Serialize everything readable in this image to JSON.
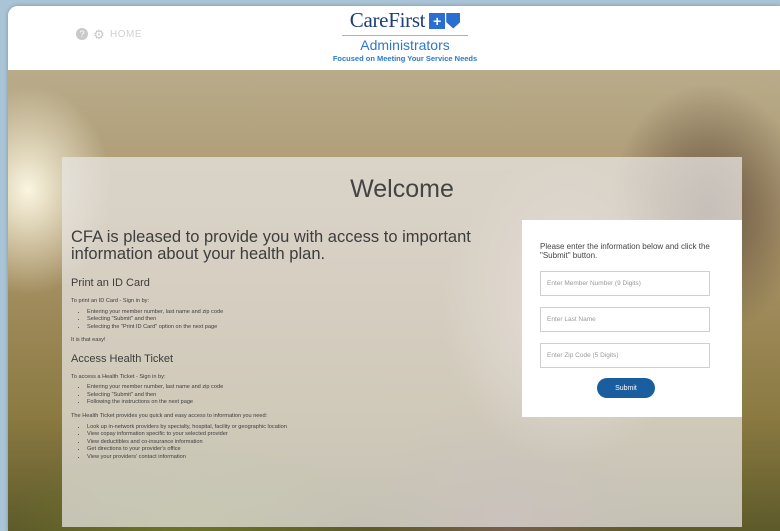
{
  "header": {
    "nav": {
      "help_icon": "?",
      "settings_icon": "⚙",
      "home_label": "HOME"
    },
    "brand": {
      "name": "CareFirst",
      "subtitle": "Administrators",
      "tagline": "Focused on Meeting Your Service Needs"
    }
  },
  "main": {
    "title": "Welcome",
    "intro": "CFA is pleased to provide you with access to important information about your health plan.",
    "print_id": {
      "heading": "Print an ID Card",
      "lead": "To print an ID Card - Sign in by:",
      "steps": [
        "Entering your member number, last name and zip code",
        "Selecting \"Submit\" and then",
        "Selecting the \"Print ID Card\" option on the next page"
      ],
      "note": "It is that easy!"
    },
    "health_ticket": {
      "heading": "Access Health Ticket",
      "lead": "To access a Health Ticket - Sign in by:",
      "steps": [
        "Entering your member number, last name and zip code",
        "Selecting \"Submit\" and then",
        "Following the instructions on the next page"
      ],
      "description": "The Health Ticket provides you quick and easy access to information you need:",
      "features": [
        "Look up in-network providers by specialty, hospital, facility or geographic location",
        "View copay information specific to your selected provider",
        "View deductibles and co-insurance information",
        "Get directions to your provider's office",
        "View your providers' contact information"
      ]
    }
  },
  "login": {
    "instructions": "Please enter the information below and click the \"Submit\" button.",
    "member_placeholder": "Enter Member Number (9 Digits)",
    "last_name_placeholder": "Enter Last Name",
    "zip_placeholder": "Enter Zip Code (5 Digits)",
    "submit_label": "Submit"
  },
  "colors": {
    "brand_navy": "#1d3f7a",
    "brand_blue": "#2f78c8",
    "submit_button": "#1a5e9f"
  }
}
